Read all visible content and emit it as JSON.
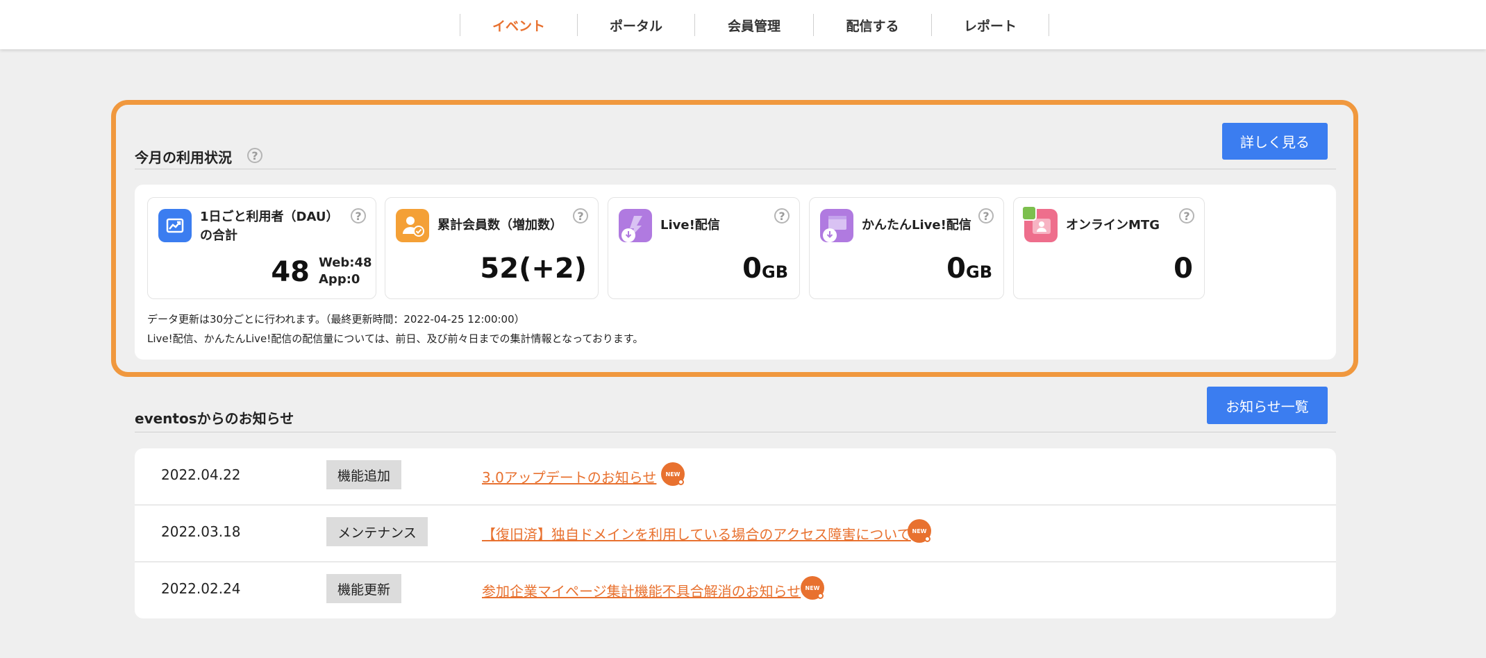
{
  "nav": {
    "items": [
      {
        "label": "イベント",
        "active": true
      },
      {
        "label": "ポータル"
      },
      {
        "label": "会員管理"
      },
      {
        "label": "配信する"
      },
      {
        "label": "レポート"
      }
    ]
  },
  "usage": {
    "title": "今月の利用状況",
    "help": "?",
    "detail_button": "詳しく見る",
    "cards": [
      {
        "title_line1": "1日ごと利用者（DAU）",
        "title_line2": "の合計",
        "value": "48",
        "web": "Web:48",
        "app": "App:0",
        "icon": "chart-icon"
      },
      {
        "title": "累計会員数（増加数）",
        "value": "52(+2)",
        "icon": "member-icon"
      },
      {
        "title": "Live!配信",
        "value": "0",
        "unit": "GB",
        "icon": "live-icon"
      },
      {
        "title": "かんたんLive!配信",
        "value": "0",
        "unit": "GB",
        "icon": "easy-live-icon"
      },
      {
        "title": "オンラインMTG",
        "value": "0",
        "icon": "meeting-icon"
      }
    ],
    "note1": "データ更新は30分ごとに行われます。（最終更新時間：2022-04-25 12:00:00）",
    "note2": "Live!配信、かんたんLive!配信の配信量については、前日、及び前々日までの集計情報となっております。"
  },
  "news": {
    "title": "eventosからのお知らせ",
    "list_button": "お知らせ一覧",
    "badge": "NEW",
    "items": [
      {
        "date": "2022.04.22",
        "tag": "機能追加",
        "text": "3.0アップデートのお知らせ"
      },
      {
        "date": "2022.03.18",
        "tag": "メンテナンス",
        "text": "【復旧済】独自ドメインを利用している場合のアクセス障害について"
      },
      {
        "date": "2022.02.24",
        "tag": "機能更新",
        "text": "参加企業マイページ集計機能不具合解消のお知らせ"
      }
    ]
  },
  "colors": {
    "accent_orange": "#e8712f",
    "frame_orange": "#f0983e",
    "button_blue": "#3b7df0"
  }
}
